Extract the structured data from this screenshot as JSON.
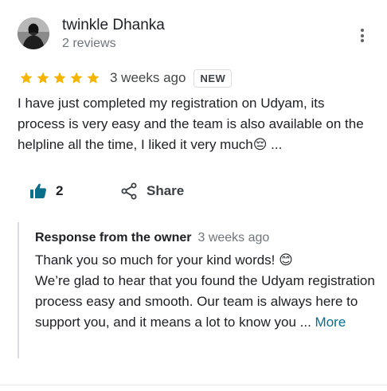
{
  "author": {
    "name": "twinkle Dhanka",
    "meta": "2 reviews"
  },
  "rating": {
    "stars": 5,
    "max": 5,
    "star_color": "#f4b400",
    "date": "3 weeks ago",
    "badge": "NEW"
  },
  "review": {
    "text": "I have just completed my registration on Udyam, its process is very easy and the team is also available on the helpline all the time, I liked it very much😔 ..."
  },
  "actions": {
    "like_count": "2",
    "share_label": "Share",
    "like_icon": "thumbs-up-icon",
    "share_icon": "share-icon"
  },
  "owner_response": {
    "title": "Response from the owner",
    "date": "3 weeks ago",
    "line1": "Thank you so much for your kind words! 😊",
    "line2": "We’re glad to hear that you found the Udyam registration process easy and smooth. Our team is always here to support you, and it means a lot to know you ...",
    "more_label": "More"
  },
  "colors": {
    "accent": "#0b6e8a",
    "star": "#f4b400"
  }
}
